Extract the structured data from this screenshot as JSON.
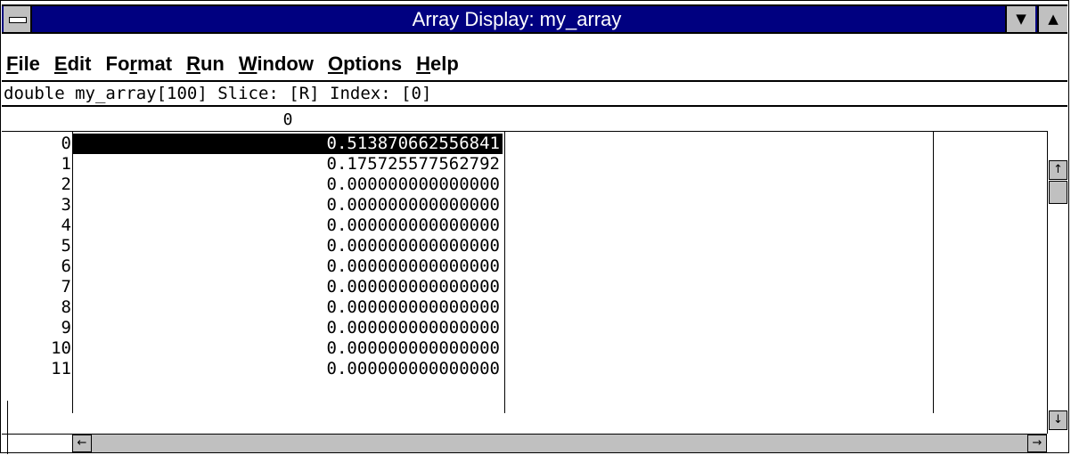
{
  "window": {
    "title": "Array Display: my_array",
    "minimize_glyph": "▼",
    "maximize_glyph": "▲"
  },
  "menu": [
    {
      "accel": "F",
      "rest": "ile"
    },
    {
      "accel": "E",
      "rest": "dit"
    },
    {
      "pre": "Fo",
      "accel": "r",
      "rest": "mat"
    },
    {
      "accel": "R",
      "rest": "un"
    },
    {
      "accel": "W",
      "rest": "indow"
    },
    {
      "accel": "O",
      "rest": "ptions"
    },
    {
      "accel": "H",
      "rest": "elp"
    }
  ],
  "info_line": "double my_array[100] Slice: [R] Index: [0]",
  "column_header": "0",
  "rows": [
    {
      "index": "0",
      "value": "0.513870662556841"
    },
    {
      "index": "1",
      "value": "0.175725577562792"
    },
    {
      "index": "2",
      "value": "0.000000000000000"
    },
    {
      "index": "3",
      "value": "0.000000000000000"
    },
    {
      "index": "4",
      "value": "0.000000000000000"
    },
    {
      "index": "5",
      "value": "0.000000000000000"
    },
    {
      "index": "6",
      "value": "0.000000000000000"
    },
    {
      "index": "7",
      "value": "0.000000000000000"
    },
    {
      "index": "8",
      "value": "0.000000000000000"
    },
    {
      "index": "9",
      "value": "0.000000000000000"
    },
    {
      "index": "10",
      "value": "0.000000000000000"
    },
    {
      "index": "11",
      "value": "0.000000000000000"
    }
  ],
  "selected_row": 0,
  "icons": {
    "system_menu": "system-menu-icon",
    "scroll_up": "↑",
    "scroll_down": "↓",
    "scroll_left": "←",
    "scroll_right": "→"
  },
  "colors": {
    "titlebar": "#000080",
    "selection_bg": "#000000",
    "selection_fg": "#ffffff",
    "chrome": "#c0c0c0"
  }
}
